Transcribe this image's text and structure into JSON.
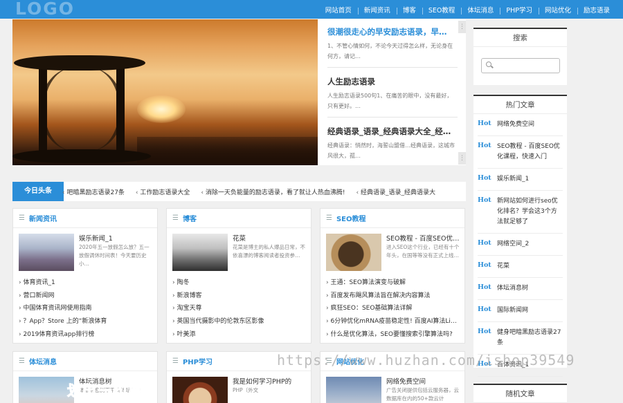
{
  "header": {
    "logo": "LOGO",
    "nav": [
      "网站首页",
      "新闻资讯",
      "博客",
      "SEO教程",
      "体坛消息",
      "PHP学习",
      "网站优化",
      "励志语录"
    ]
  },
  "featured": [
    {
      "title": "很潮很走心的早安励志语录，早…",
      "desc": "1、不管心情如何，不论今天过得怎么样，无论身在何方，请记…"
    },
    {
      "title": "人生励志语录",
      "desc": "人生励志语录500句1、在痛苦的眼中，没有最好，只有更好。…"
    },
    {
      "title": "经典语录_语录_经典语录大全_经…",
      "desc": "经典语录：悄然时，海誓山盟借…经典语录，这城市风很大，孤…"
    }
  ],
  "ticker": {
    "label": "今日头条",
    "items": [
      "吧暗黑励志语录27条",
      "工作励志语录大全",
      "消除一天负能量的励志语录，看了就让人热血沸腾!",
      "经典语录_语录_经典语录大"
    ]
  },
  "cards": [
    {
      "title": "新闻资讯",
      "feat_title": "娱乐新闻_1",
      "feat_desc": "2020年五一放假怎么放？五一放假调休时间表！今天要历史小…",
      "items": [
        "体育资讯_1",
        "营口新闻网",
        "中国体育资讯网使用指南",
        "？App？Store 上的“新浪体育",
        "2019体育资讯app排行榜"
      ]
    },
    {
      "title": "博客",
      "feat_title": "花菜",
      "feat_desc": "花菜是博主的私人爆品日常，不依喜漂的博客阅读者投资参…",
      "items": [
        "陶冬",
        "新浪博客",
        "淘宝天尊",
        "英国当代摄影中的伦敦东区影像",
        "叶美添"
      ]
    },
    {
      "title": "SEO教程",
      "feat_title": "SEO教程 - 百度SEO优…",
      "feat_desc": "进入SEO这个行业，已经有十个年头，在国等等没有正式上线…",
      "items": [
        "王通：SEO算法演变与破解",
        "百度发布飓风算法旨在解决内容算法",
        "疯狂SEO：SEO基础算法详解",
        "6分钟优化mRNA疫苗稳定性! 百度AI算法Li…",
        "什么是优化算法，SEO要懂搜索引擎算法吗?"
      ]
    },
    {
      "title": "体坛消息",
      "feat_title": "体坛消息树",
      "feat_desc": "体坛消息树下平均体坛消息",
      "items": []
    },
    {
      "title": "PHP学习",
      "feat_title": "我是如何学习PHP的",
      "feat_desc": "PHP（外文",
      "items": []
    },
    {
      "title": "网站优化",
      "feat_title": "网络免费空间",
      "feat_desc": "广告关闭提供包括云服务器，云数据库在内的50+款云计",
      "items": []
    }
  ],
  "sidebar": {
    "search_title": "搜索",
    "search_placeholder": "",
    "hot_title": "热门文章",
    "hot_tag": "Hot",
    "hot_items": [
      "网络免费空间",
      "SEO教程 - 百度SEO优化课程，快速入门",
      "娱乐新闻_1",
      "新网站如何进行seo优化排名？学会这3个方法就足够了",
      "网络空间_2",
      "花菜",
      "体坛消息树",
      "国际新闻网",
      "健身吧暗黑励志语录27条",
      "百体资讯_1"
    ],
    "random_title": "随机文章"
  },
  "watermark": "https://www.huzhan.com/ishop39549",
  "overlay_text": "划出一句离别"
}
